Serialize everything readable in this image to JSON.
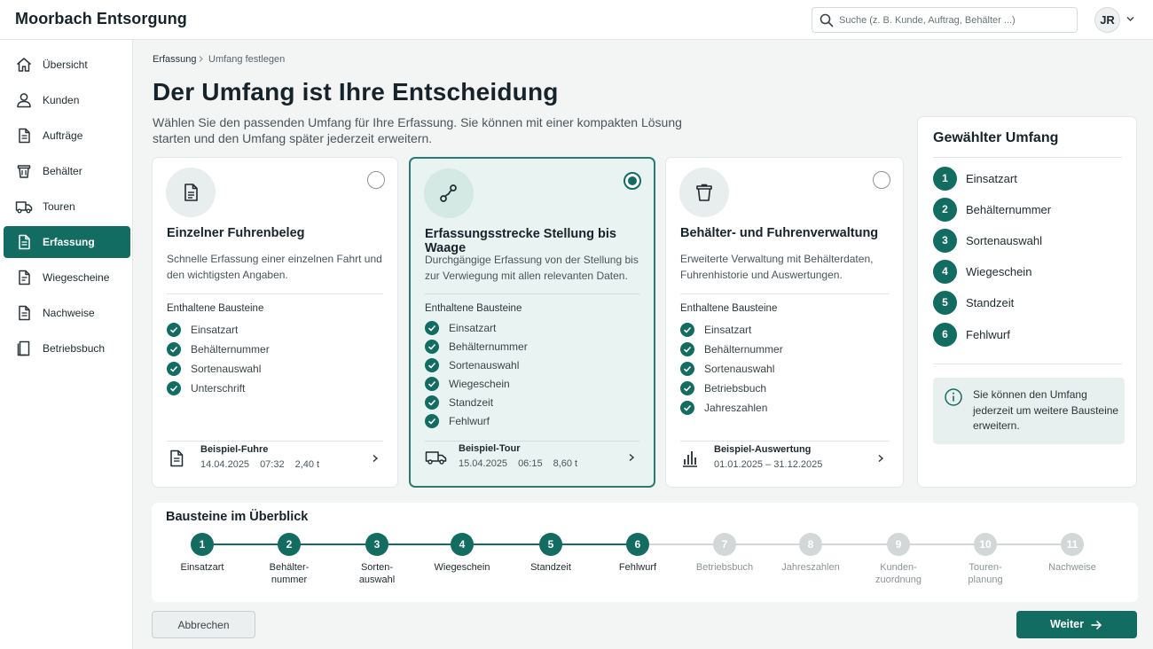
{
  "app": {
    "title": "Moorbach Entsorgung"
  },
  "search": {
    "placeholder": "Suche (z. B. Kunde, Auftrag, Behälter ...)"
  },
  "user": {
    "initials": "JR"
  },
  "sidebar": {
    "items": [
      {
        "label": "Übersicht",
        "icon": "home-icon"
      },
      {
        "label": "Kunden",
        "icon": "user-icon"
      },
      {
        "label": "Aufträge",
        "icon": "document-icon"
      },
      {
        "label": "Behälter",
        "icon": "bin-icon"
      },
      {
        "label": "Touren",
        "icon": "truck-icon"
      },
      {
        "label": "Erfassung",
        "icon": "form-icon",
        "active": true
      },
      {
        "label": "Wiegescheine",
        "icon": "receipt-icon"
      },
      {
        "label": "Nachweise",
        "icon": "certificate-icon"
      },
      {
        "label": "Betriebsbuch",
        "icon": "book-icon"
      }
    ]
  },
  "breadcrumb": {
    "parent": "Erfassung",
    "current": "Umfang festlegen"
  },
  "page": {
    "title": "Der Umfang ist Ihre Entscheidung",
    "description": "Wählen Sie den passenden Umfang für Ihre Erfassung. Sie können mit einer kompakten Lösung starten und den Umfang später jederzeit erweitern."
  },
  "cards": [
    {
      "title": "Einzelner Fuhrenbeleg",
      "description": "Schnelle Erfassung einer einzelnen Fahrt und den wichtigsten Angaben.",
      "selected": false,
      "includes_label": "Enthaltene Bausteine",
      "features": [
        "Einsatzart",
        "Behälternummer",
        "Sortenauswahl",
        "Unterschrift"
      ],
      "example": {
        "title": "Beispiel-Fuhre",
        "date": "14.04.2025",
        "time": "07:32",
        "weight": "2,40 t",
        "icon": "document-icon"
      }
    },
    {
      "title": "Erfassungsstrecke Stellung bis Waage",
      "description": "Durchgängige Erfassung von der Stellung bis zur Verwiegung mit allen relevanten Daten.",
      "selected": true,
      "includes_label": "Enthaltene Bausteine",
      "features": [
        "Einsatzart",
        "Behälternummer",
        "Sortenauswahl",
        "Wiegeschein",
        "Standzeit",
        "Fehlwurf"
      ],
      "example": {
        "title": "Beispiel-Tour",
        "date": "15.04.2025",
        "time": "06:15",
        "weight": "8,60 t",
        "icon": "truck-icon"
      }
    },
    {
      "title": "Behälter- und Fuhrenverwaltung",
      "description": "Erweiterte Verwaltung mit Behälterdaten, Fuhrenhistorie und Auswertungen.",
      "selected": false,
      "includes_label": "Enthaltene Bausteine",
      "features": [
        "Einsatzart",
        "Behälternummer",
        "Sortenauswahl",
        "Betriebsbuch",
        "Jahreszahlen"
      ],
      "example": {
        "title": "Beispiel-Auswertung",
        "range": "01.01.2025 – 31.12.2025",
        "icon": "bar-chart-icon"
      }
    }
  ],
  "summary": {
    "title": "Gewählter Umfang",
    "steps": [
      {
        "num": "1",
        "label": "Einsatzart"
      },
      {
        "num": "2",
        "label": "Behälternummer"
      },
      {
        "num": "3",
        "label": "Sortenauswahl"
      },
      {
        "num": "4",
        "label": "Wiegeschein"
      },
      {
        "num": "5",
        "label": "Standzeit"
      },
      {
        "num": "6",
        "label": "Fehlwurf"
      }
    ],
    "info": "Sie können den Umfang jederzeit um weitere Bausteine erweitern."
  },
  "overview": {
    "title": "Bausteine im Überblick",
    "steps": [
      {
        "num": "1",
        "label": "Einsatzart",
        "active": true
      },
      {
        "num": "2",
        "label": "Behälter-\nnummer",
        "active": true
      },
      {
        "num": "3",
        "label": "Sorten-\nauswahl",
        "active": true
      },
      {
        "num": "4",
        "label": "Wiegeschein",
        "active": true
      },
      {
        "num": "5",
        "label": "Standzeit",
        "active": true
      },
      {
        "num": "6",
        "label": "Fehlwurf",
        "active": true
      },
      {
        "num": "7",
        "label": "Betriebsbuch",
        "active": false
      },
      {
        "num": "8",
        "label": "Jahreszahlen",
        "active": false
      },
      {
        "num": "9",
        "label": "Kunden-\nzuordnung",
        "active": false
      },
      {
        "num": "10",
        "label": "Touren-\nplanung",
        "active": false
      },
      {
        "num": "11",
        "label": "Nachweise",
        "active": false
      }
    ]
  },
  "actions": {
    "cancel": "Abbrechen",
    "next": "Weiter"
  },
  "colors": {
    "accent": "#136c61",
    "inactive": "#d3d7d8",
    "selected_bg": "#e9f3f1"
  }
}
